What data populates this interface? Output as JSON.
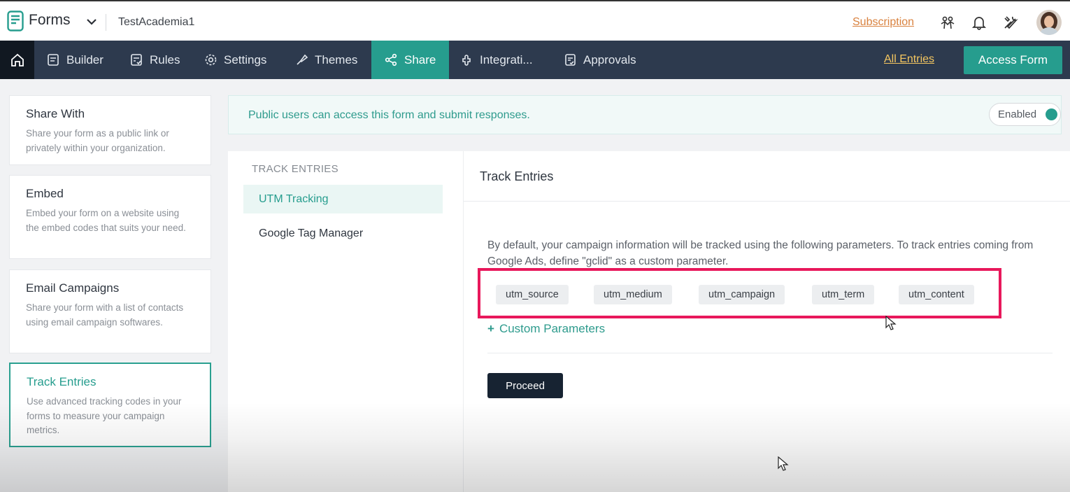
{
  "app": {
    "name": "Forms",
    "form_name": "TestAcademia1"
  },
  "header": {
    "subscription_label": "Subscription",
    "icons": [
      "team-icon",
      "bell-icon",
      "tools-icon"
    ]
  },
  "nav": {
    "tabs": [
      {
        "label": "Builder",
        "icon": "builder-icon"
      },
      {
        "label": "Rules",
        "icon": "rules-icon"
      },
      {
        "label": "Settings",
        "icon": "gear-icon"
      },
      {
        "label": "Themes",
        "icon": "themes-icon"
      },
      {
        "label": "Share",
        "icon": "share-icon",
        "active": true
      },
      {
        "label": "Integrati...",
        "icon": "integrations-icon"
      },
      {
        "label": "Approvals",
        "icon": "approvals-icon"
      }
    ],
    "all_entries_label": "All Entries",
    "access_form_label": "Access Form"
  },
  "share_options": [
    {
      "title": "Share With",
      "desc": "Share your form as a public link or privately within your organization."
    },
    {
      "title": "Embed",
      "desc": "Embed your form on a website using the embed codes that suits your need."
    },
    {
      "title": "Email Campaigns",
      "desc": "Share your form with a list of contacts using email campaign softwares."
    },
    {
      "title": "Track Entries",
      "desc": "Use advanced tracking codes in your forms to measure your campaign metrics.",
      "selected": true
    }
  ],
  "notice": {
    "text": "Public users can access this form and submit responses.",
    "status_label": "Enabled"
  },
  "track_menu": {
    "heading": "TRACK ENTRIES",
    "items": [
      "UTM Tracking",
      "Google Tag Manager"
    ],
    "active": "UTM Tracking"
  },
  "track_content": {
    "title": "Track Entries",
    "description": "By default, your campaign information will be tracked using the following parameters. To track entries coming from Google Ads, define \"gclid\" as a custom parameter.",
    "parameters": [
      "utm_source",
      "utm_medium",
      "utm_campaign",
      "utm_term",
      "utm_content"
    ],
    "custom_label": "Custom Parameters",
    "proceed_label": "Proceed"
  },
  "colors": {
    "accent": "#269d8e",
    "nav_bg": "#2d3a4e",
    "highlight": "#e8185b",
    "subscription": "#d9823f",
    "all_entries": "#f4c660"
  }
}
